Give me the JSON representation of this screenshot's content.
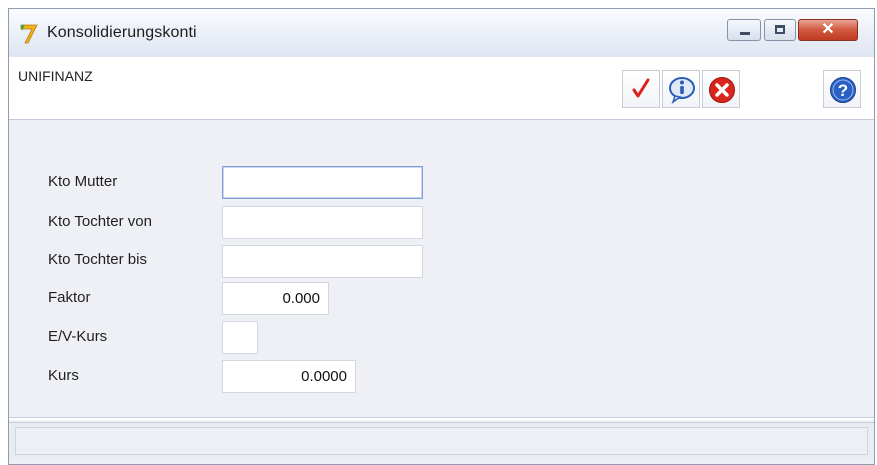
{
  "window": {
    "title": "Konsolidierungskonti",
    "controls": {
      "minimize": "minimize-icon",
      "maximize": "maximize-icon",
      "close": "close-icon"
    }
  },
  "toolbar": {
    "company": "UNIFINANZ",
    "buttons": [
      {
        "icon": "checkmark-icon",
        "color": "#e0201b"
      },
      {
        "icon": "info-icon",
        "color": "#2b5db8"
      },
      {
        "icon": "cancel-icon",
        "color": "#d8261c"
      },
      {
        "icon": "help-icon",
        "color": "#2a5fc4"
      }
    ]
  },
  "form": {
    "fields": [
      {
        "label": "Kto Mutter",
        "value": ""
      },
      {
        "label": "Kto Tochter von",
        "value": ""
      },
      {
        "label": "Kto Tochter bis",
        "value": ""
      },
      {
        "label": "Faktor",
        "value": "0.000"
      },
      {
        "label": "E/V-Kurs",
        "value": ""
      },
      {
        "label": "Kurs",
        "value": "0.0000"
      }
    ]
  },
  "colors": {
    "background": "#eef0f6",
    "focus_border": "#7b9fd6"
  }
}
